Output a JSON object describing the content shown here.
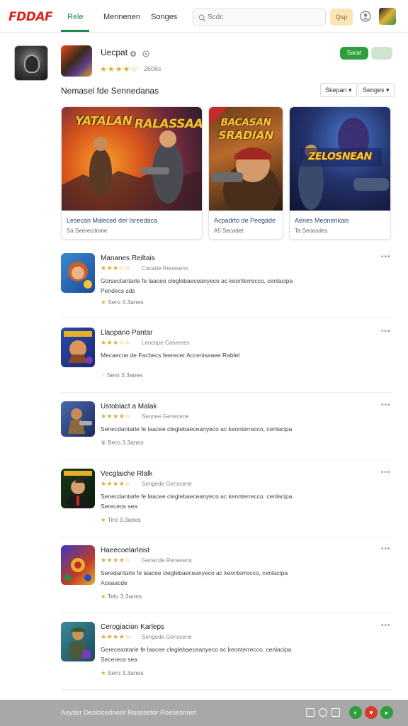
{
  "header": {
    "logo": "FDDAF",
    "tabs": [
      {
        "label": "Rele",
        "active": true
      },
      {
        "label": "Mennenen",
        "active": false
      },
      {
        "label": "Songes",
        "active": false
      }
    ],
    "search_placeholder": "Scdc",
    "search_button": "Qsp"
  },
  "featured": {
    "title": "Uecpat",
    "stars": "★★★★☆",
    "rating_text": "2606s",
    "primary_button": "Sacat",
    "secondary_button": ""
  },
  "section": {
    "title": "Nemasel fde Sennedanas",
    "filters": [
      "Skepan ▾",
      "Senges ▾"
    ]
  },
  "cards": [
    {
      "art_title_1": "YATALAN",
      "art_title_2": "RALASSAA",
      "title": "Lesecan Maleced der Isreedaca",
      "subtitle": "Sa Seerecdome"
    },
    {
      "art_title_1": "BACASAN",
      "art_title_2": "SRADIAN",
      "title": "Acpadrto de Peegade",
      "subtitle": "A5 Secadet"
    },
    {
      "art_title_1": "ZELOSNEAN",
      "art_title_2": "",
      "title": "Aenes Meonenkais",
      "subtitle": "Ta Seoasdes"
    }
  ],
  "list": [
    {
      "name": "Mananes Reiltais",
      "stars": "★★★☆☆",
      "rating": "Cacade Renesens",
      "desc": "Gorsectantarle fe laacee cleglebaeceanyeco ac keonterrecco, cenlacipa Pendecs sds",
      "meta": "Sero 3.3anes",
      "meta_star": "★"
    },
    {
      "name": "Llaopano Pantar",
      "stars": "★★★☆☆",
      "rating": "Leocepe Canerees",
      "desc": "Mecaecne de Facbecs feerecer Acceniseaee Rablel",
      "meta": "Sero 3.3anes",
      "meta_star": "♂"
    },
    {
      "name": "Ustoblact a Malak",
      "stars": "★★★★☆",
      "rating": "Seonee Genecene",
      "desc": "Senecdantarle fe laacee cleglebaeceanyeco ac keonterrecco, cenlacipa",
      "meta": "Bero 3.3anes",
      "meta_star": "♛"
    },
    {
      "name": "Vecglaiche Rlalk",
      "stars": "★★★★☆",
      "rating": "Sengede Genscene",
      "desc": "Senecdantarle fe laacee cleglebaeceanyeco ac keonterrecco, cenlacipa Sereceos sea",
      "meta": "Tiro 3.3anes",
      "meta_star": "★"
    },
    {
      "name": "Haeecoelarleist",
      "stars": "★★★★☆",
      "rating": "Genecde Renesens",
      "desc": "Seredantarle fe laacee cleglebaeceanyeco ac keonterrecco, cenlacipa Aceaacde",
      "meta": "Telo 3.3anes",
      "meta_star": "★"
    },
    {
      "name": "Cerogiacion Karleps",
      "stars": "★★★★☆",
      "rating": "Sengede Genscene",
      "desc": "Gereceantarle fe laacee cleglebaeceanyeco ac keonterrecco, cenlacipa Secereos sea",
      "meta": "Sero 3.3anes",
      "meta_star": "★"
    }
  ],
  "footer": {
    "text": "Aeytler Debiocednoer Rasesetor Roesesnnet"
  },
  "colors": {
    "accent_green": "#1e8a4a",
    "button_green": "#2e9e3e",
    "star_gold": "#e1b12c",
    "footer_gray": "#a7a8a7",
    "logo_red": "#d8261f"
  }
}
